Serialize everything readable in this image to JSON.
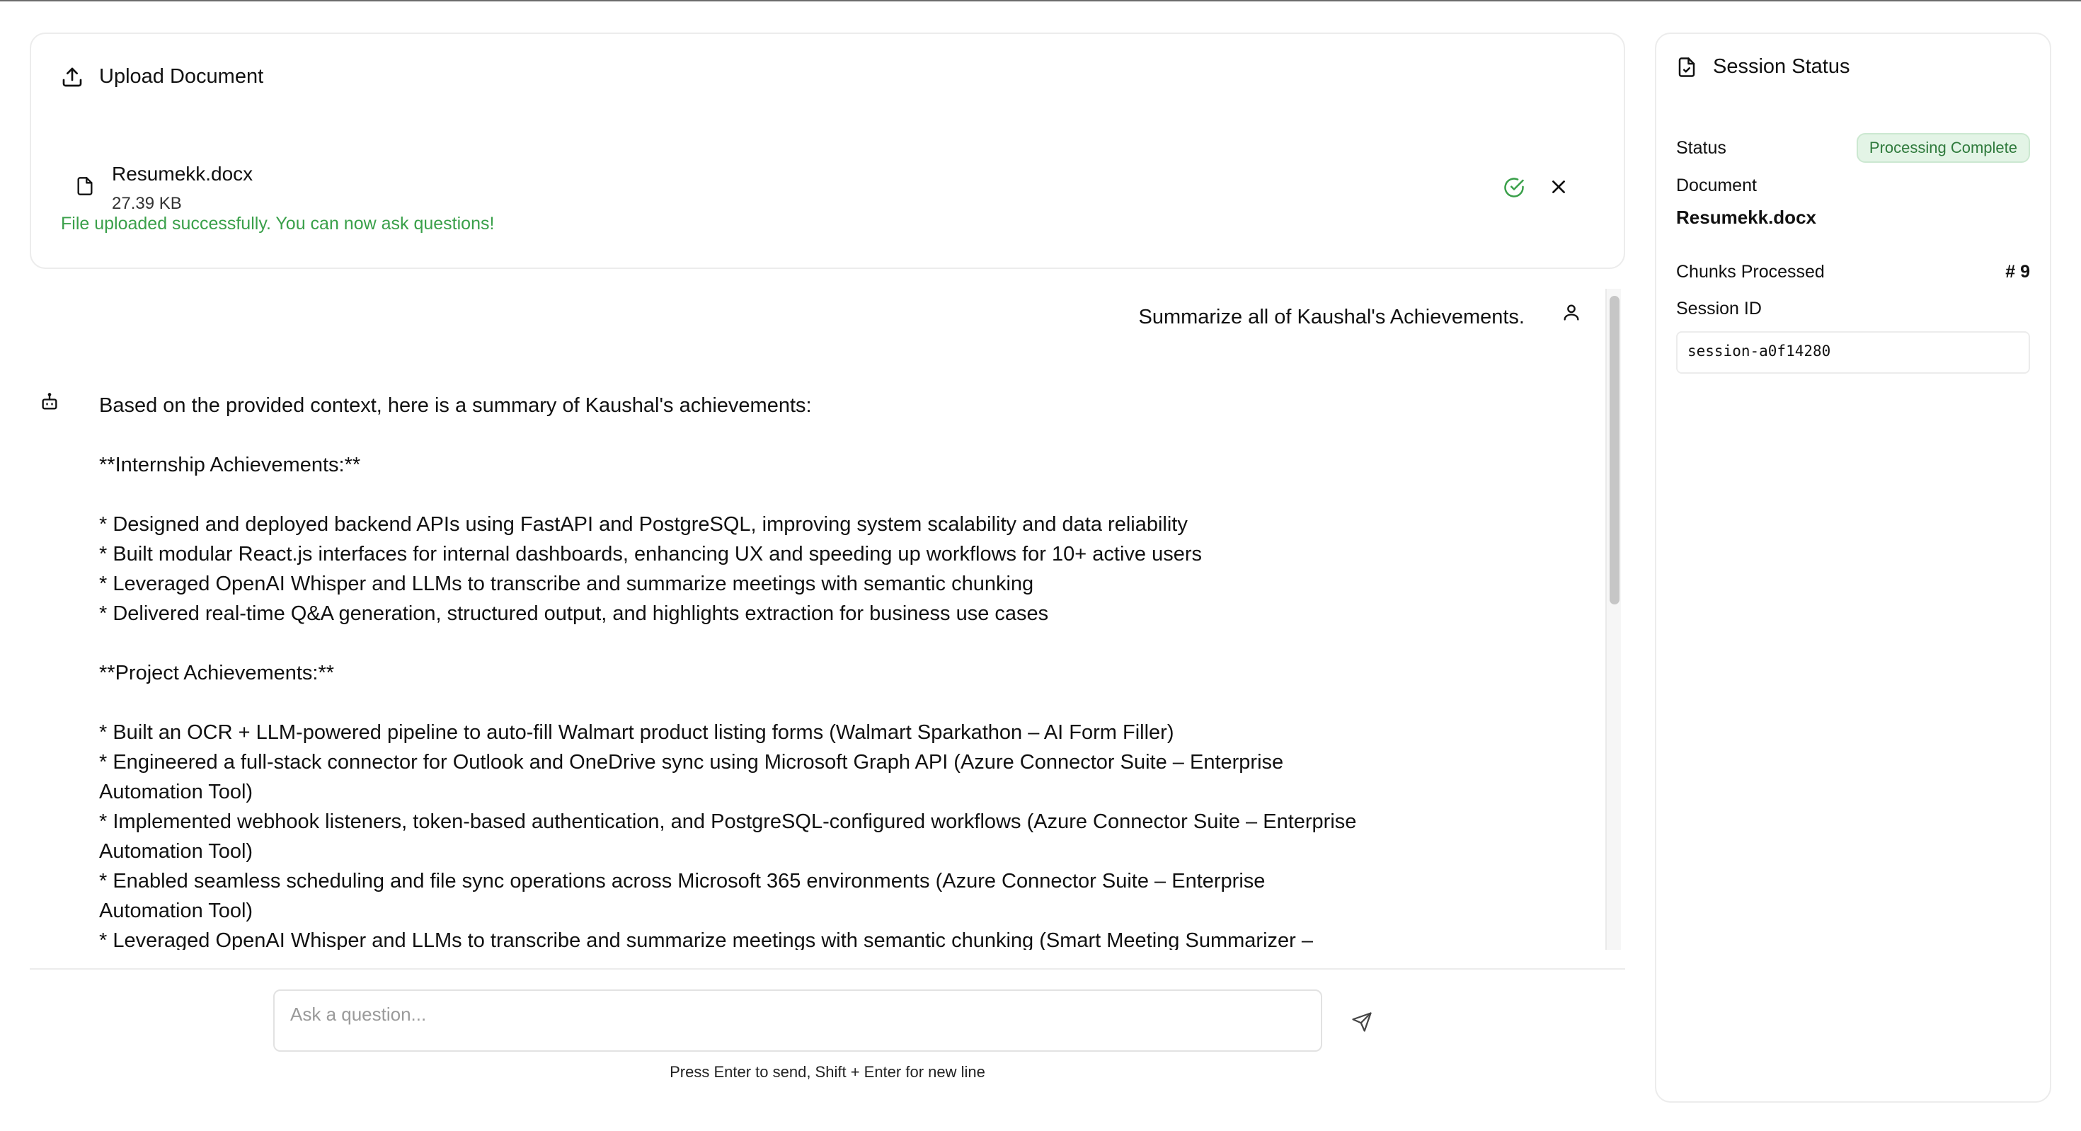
{
  "upload": {
    "title": "Upload Document",
    "file_name": "Resumekk.docx",
    "file_size": "27.39 KB",
    "success_message": "File uploaded successfully. You can now ask questions!"
  },
  "chat": {
    "user_message": "Summarize all of Kaushal's Achievements.",
    "bot_lines": [
      "Based on the provided context, here is a summary of Kaushal's achievements:",
      "",
      "**Internship Achievements:**",
      "",
      "* Designed and deployed backend APIs using FastAPI and PostgreSQL, improving system scalability and data reliability",
      "* Built modular React.js interfaces for internal dashboards, enhancing UX and speeding up workflows for 10+ active users",
      "* Leveraged OpenAI Whisper and LLMs to transcribe and summarize meetings with semantic chunking",
      "* Delivered real-time Q&A generation, structured output, and highlights extraction for business use cases",
      "",
      "**Project Achievements:**",
      "",
      "* Built an OCR + LLM-powered pipeline to auto-fill Walmart product listing forms (Walmart Sparkathon – AI Form Filler)",
      "* Engineered a full-stack connector for Outlook and OneDrive sync using Microsoft Graph API (Azure Connector Suite – Enterprise Automation Tool)",
      "* Implemented webhook listeners, token-based authentication, and PostgreSQL-configured workflows (Azure Connector Suite – Enterprise Automation Tool)",
      "* Enabled seamless scheduling and file sync operations across Microsoft 365 environments (Azure Connector Suite – Enterprise Automation Tool)",
      "* Leveraged OpenAI Whisper and LLMs to transcribe and summarize meetings with semantic chunking (Smart Meeting Summarizer –"
    ]
  },
  "composer": {
    "placeholder": "Ask a question...",
    "hint": "Press Enter to send, Shift + Enter for new line"
  },
  "session": {
    "title": "Session Status",
    "status_label": "Status",
    "status_value": "Processing Complete",
    "document_label": "Document",
    "document_value": "Resumekk.docx",
    "chunks_label": "Chunks Processed",
    "chunks_value": "# 9",
    "session_id_label": "Session ID",
    "session_id_value": "session-a0f14280"
  },
  "colors": {
    "success": "#3aa04a",
    "badge_bg": "#e3f4e6",
    "badge_text": "#2f7a3c"
  },
  "icons": {
    "upload": "upload-icon",
    "file": "file-icon",
    "check": "check-circle-icon",
    "close": "close-icon",
    "user": "user-icon",
    "bot": "bot-icon",
    "send": "send-icon",
    "session": "file-check-icon"
  }
}
